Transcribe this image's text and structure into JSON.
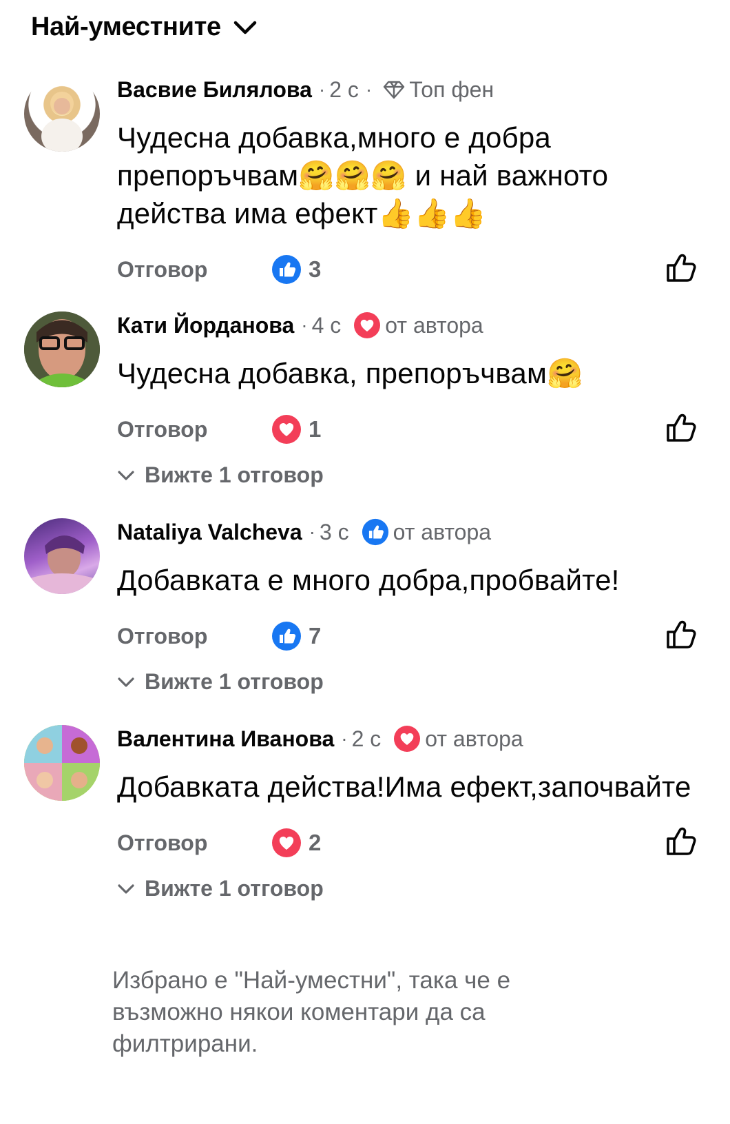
{
  "sort": {
    "label": "Най-уместните"
  },
  "comments": [
    {
      "author": "Васвие Билялова",
      "time": "2 с",
      "badge": "Топ фен",
      "text": "Чудесна добавка,много е добра препоръчвам🤗🤗🤗 и най важното действа има ефект👍👍👍",
      "reply_label": "Отговор",
      "reaction_type": "like",
      "reaction_count": "3"
    },
    {
      "author": "Кати Йорданова",
      "time": "4 с",
      "badge": "от автора",
      "text": "Чудесна добавка, препоръчвам🤗",
      "reply_label": "Отговор",
      "reaction_type": "love",
      "reaction_count": "1",
      "view_replies": "Вижте 1 отговор"
    },
    {
      "author": "Nataliya Valcheva",
      "time": "3 с",
      "badge": "от автора",
      "text": "Добавката е много добра,пробвайте!",
      "reply_label": "Отговор",
      "reaction_type": "like",
      "reaction_count": "7",
      "view_replies": "Вижте 1 отговор"
    },
    {
      "author": "Валентина Иванова",
      "time": "2 с",
      "badge": "от автора",
      "text": "Добавката действа!Има ефект,започвайте",
      "reply_label": "Отговор",
      "reaction_type": "love",
      "reaction_count": "2",
      "view_replies": "Вижте 1 отговор"
    }
  ],
  "footer_note": "Избрано е \"Най-уместни\", така че е възможно някои коментари да са филтрирани.",
  "colors": {
    "like_blue": "#1877f2",
    "love_red": "#f33e58",
    "secondary_text": "#65676b"
  }
}
